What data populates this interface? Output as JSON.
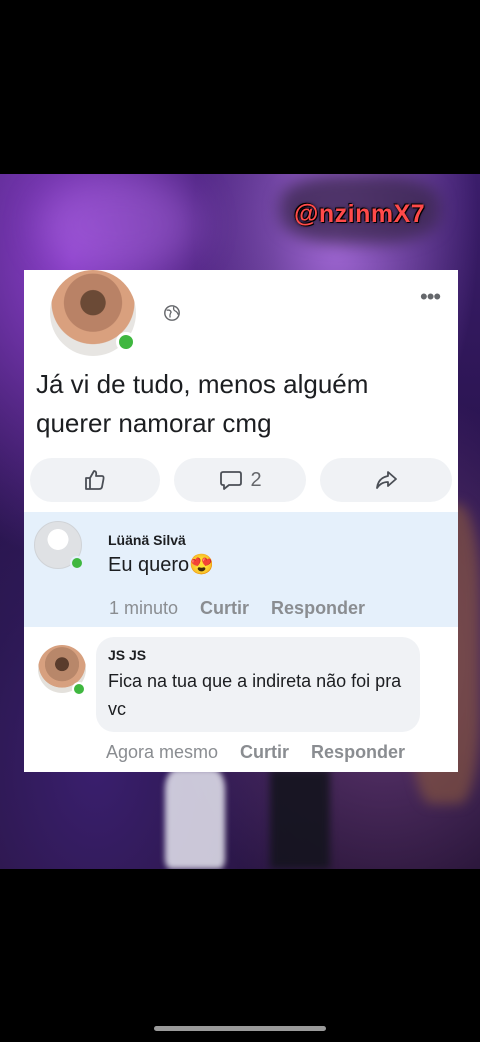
{
  "watermark": "@nzinmX7",
  "post": {
    "text": "Já vi de tudo, menos alguém querer namorar cmg",
    "actions": {
      "comment_count": "2"
    }
  },
  "comments": [
    {
      "author": "Lüänä Silvä",
      "text": "Eu quero😍",
      "time": "1 minuto",
      "like_label": "Curtir",
      "reply_label": "Responder"
    },
    {
      "author": "JS JS",
      "text": "Fica na tua que a indireta não foi pra vc",
      "time": "Agora mesmo",
      "like_label": "Curtir",
      "reply_label": "Responder"
    }
  ],
  "colors": {
    "online": "#3fb73f",
    "highlight_comment_bg": "#e5f0fb",
    "watermark": "#ff4a4a"
  },
  "icons": [
    "globe-icon",
    "more-icon",
    "like-icon",
    "comment-icon",
    "share-icon"
  ]
}
